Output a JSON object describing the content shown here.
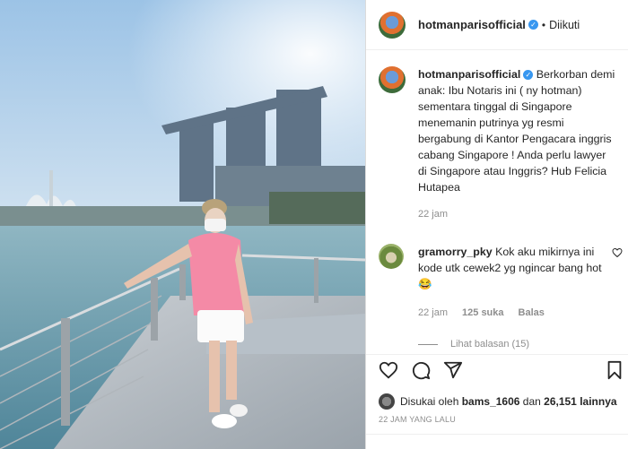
{
  "header": {
    "username": "hotmanparisofficial",
    "separator": "•",
    "follow_status": "Diikuti"
  },
  "caption": {
    "username": "hotmanparisofficial",
    "text": "Berkorban demi anak: Ibu Notaris ini ( ny hotman) sementara tinggal di Singapore menemanin putrinya yg resmi bergabung di Kantor Pengacara inggris cabang Singapore ! Anda perlu lawyer di Singapore atau Inggris? Hub Felicia Hutapea",
    "time": "22 jam"
  },
  "comment": {
    "username": "gramorry_pky",
    "text": "Kok aku mikirnya ini kode utk cewek2 yg ngincar bang hot😂",
    "time": "22 jam",
    "likes": "125 suka",
    "reply_label": "Balas",
    "view_replies": "Lihat balasan (15)"
  },
  "likes": {
    "prefix": "Disukai oleh",
    "user": "bams_1606",
    "middle": "dan",
    "count": "26,151 lainnya"
  },
  "timestamp": "22 JAM YANG LALU",
  "icons": [
    "heart-icon",
    "comment-icon",
    "share-icon",
    "bookmark-icon",
    "verified-badge-icon"
  ],
  "colors": {
    "verified": "#3897f0",
    "muted": "#8e8e8e",
    "text": "#262626"
  }
}
